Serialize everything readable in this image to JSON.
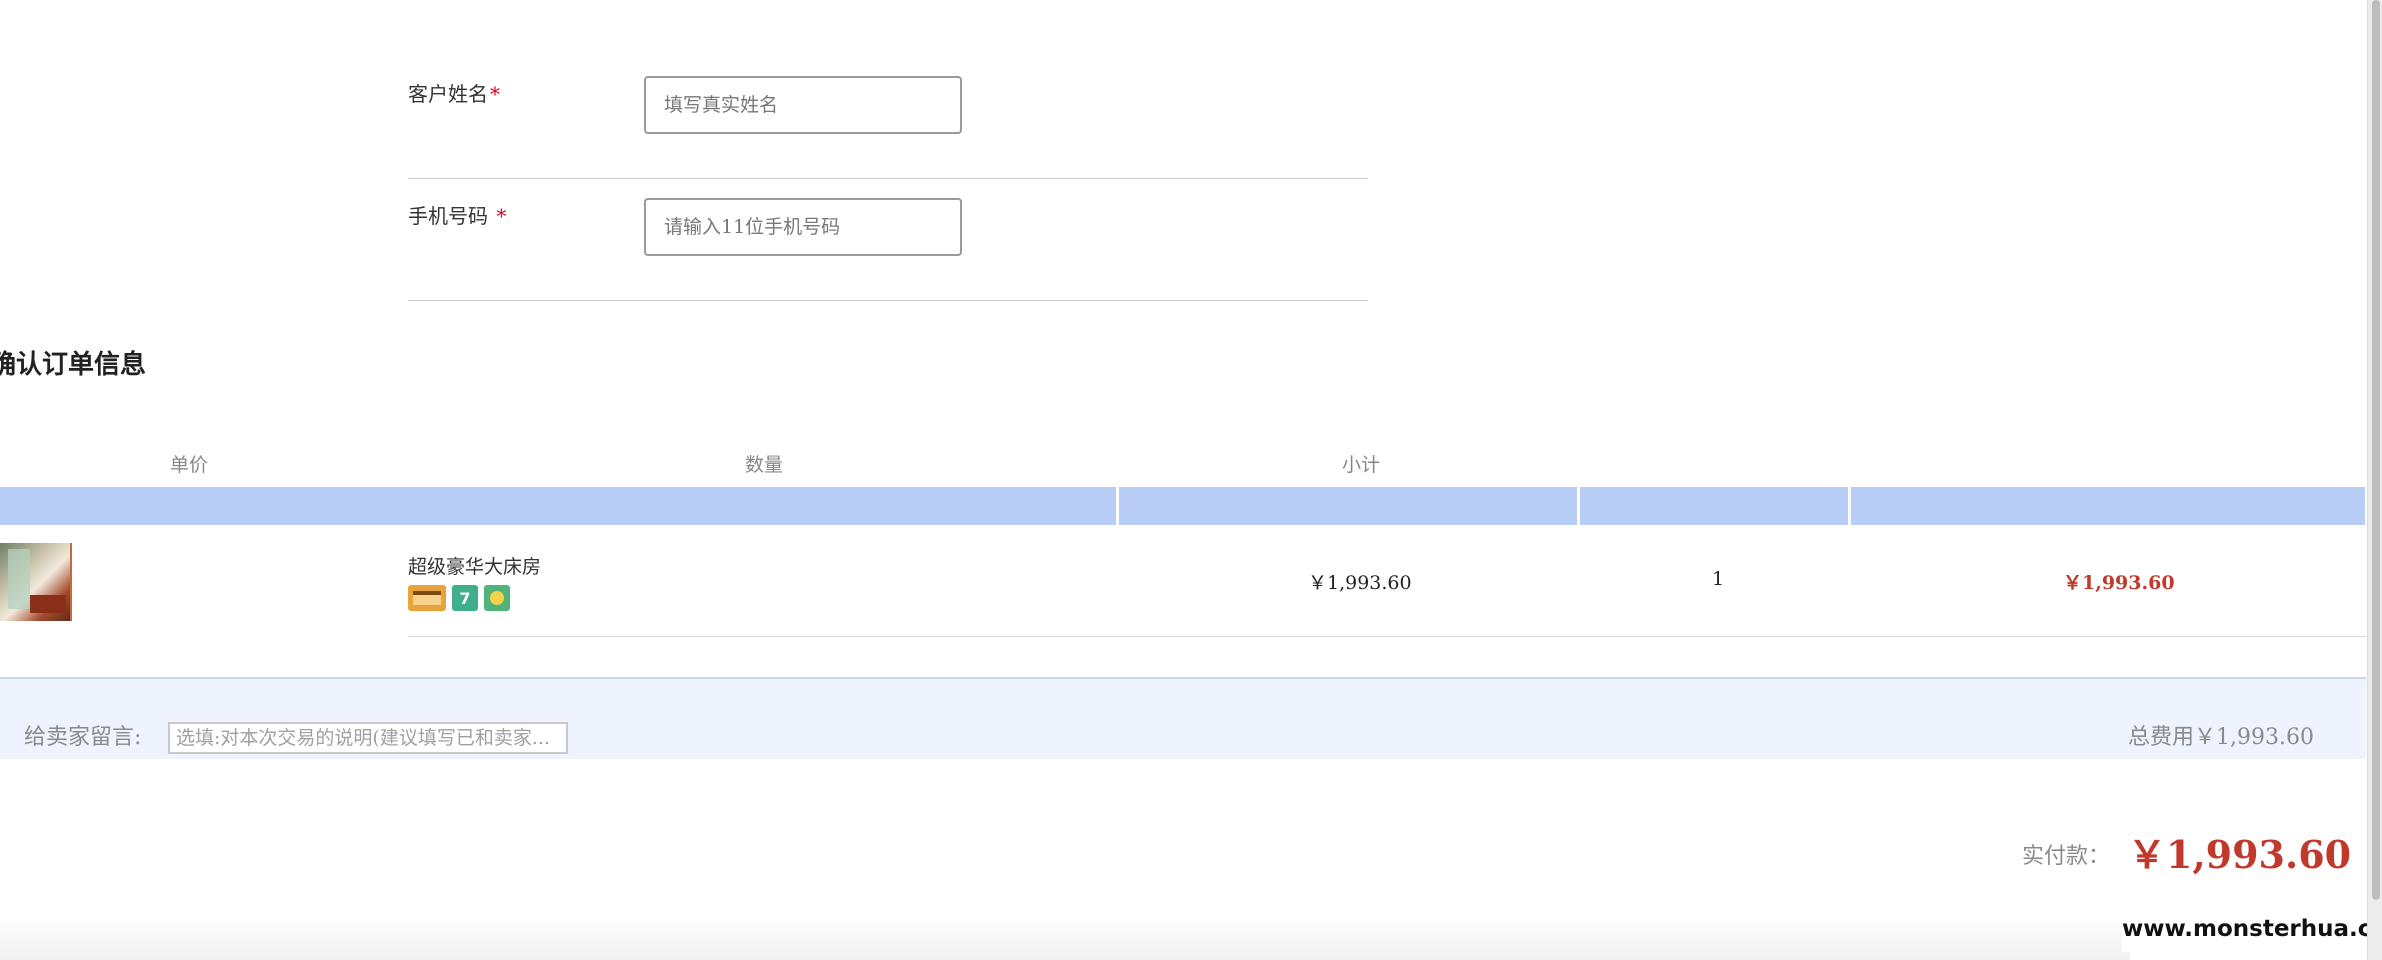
{
  "form": {
    "name_label": "客户姓名",
    "name_placeholder": "填写真实姓名",
    "phone_label": "手机号码",
    "phone_placeholder": "请输入11位手机号码",
    "required_mark": "*"
  },
  "order": {
    "section_title": "确认订单信息",
    "columns": [
      "单价",
      "数量",
      "小计"
    ],
    "item": {
      "name": "超级豪华大床房",
      "unit_price": "￥1,993.60",
      "quantity": "1",
      "subtotal": "￥1,993.60",
      "amenity_icons": [
        "card-icon",
        "seven-icon",
        "cup-icon"
      ],
      "amenity_seven": "7"
    }
  },
  "remark": {
    "label": "给卖家留言:",
    "placeholder": "选填:对本次交易的说明(建议填写已和卖家..."
  },
  "totals": {
    "total_fee": "总费用￥1,993.60",
    "paid_label": "实付款：",
    "paid_value": "￥1,993.60"
  },
  "watermark": "www.monsterhua.com",
  "colors": {
    "accent_blue": "#b8cdf6",
    "price_red": "#c0392b",
    "required_red": "#d9001b"
  }
}
